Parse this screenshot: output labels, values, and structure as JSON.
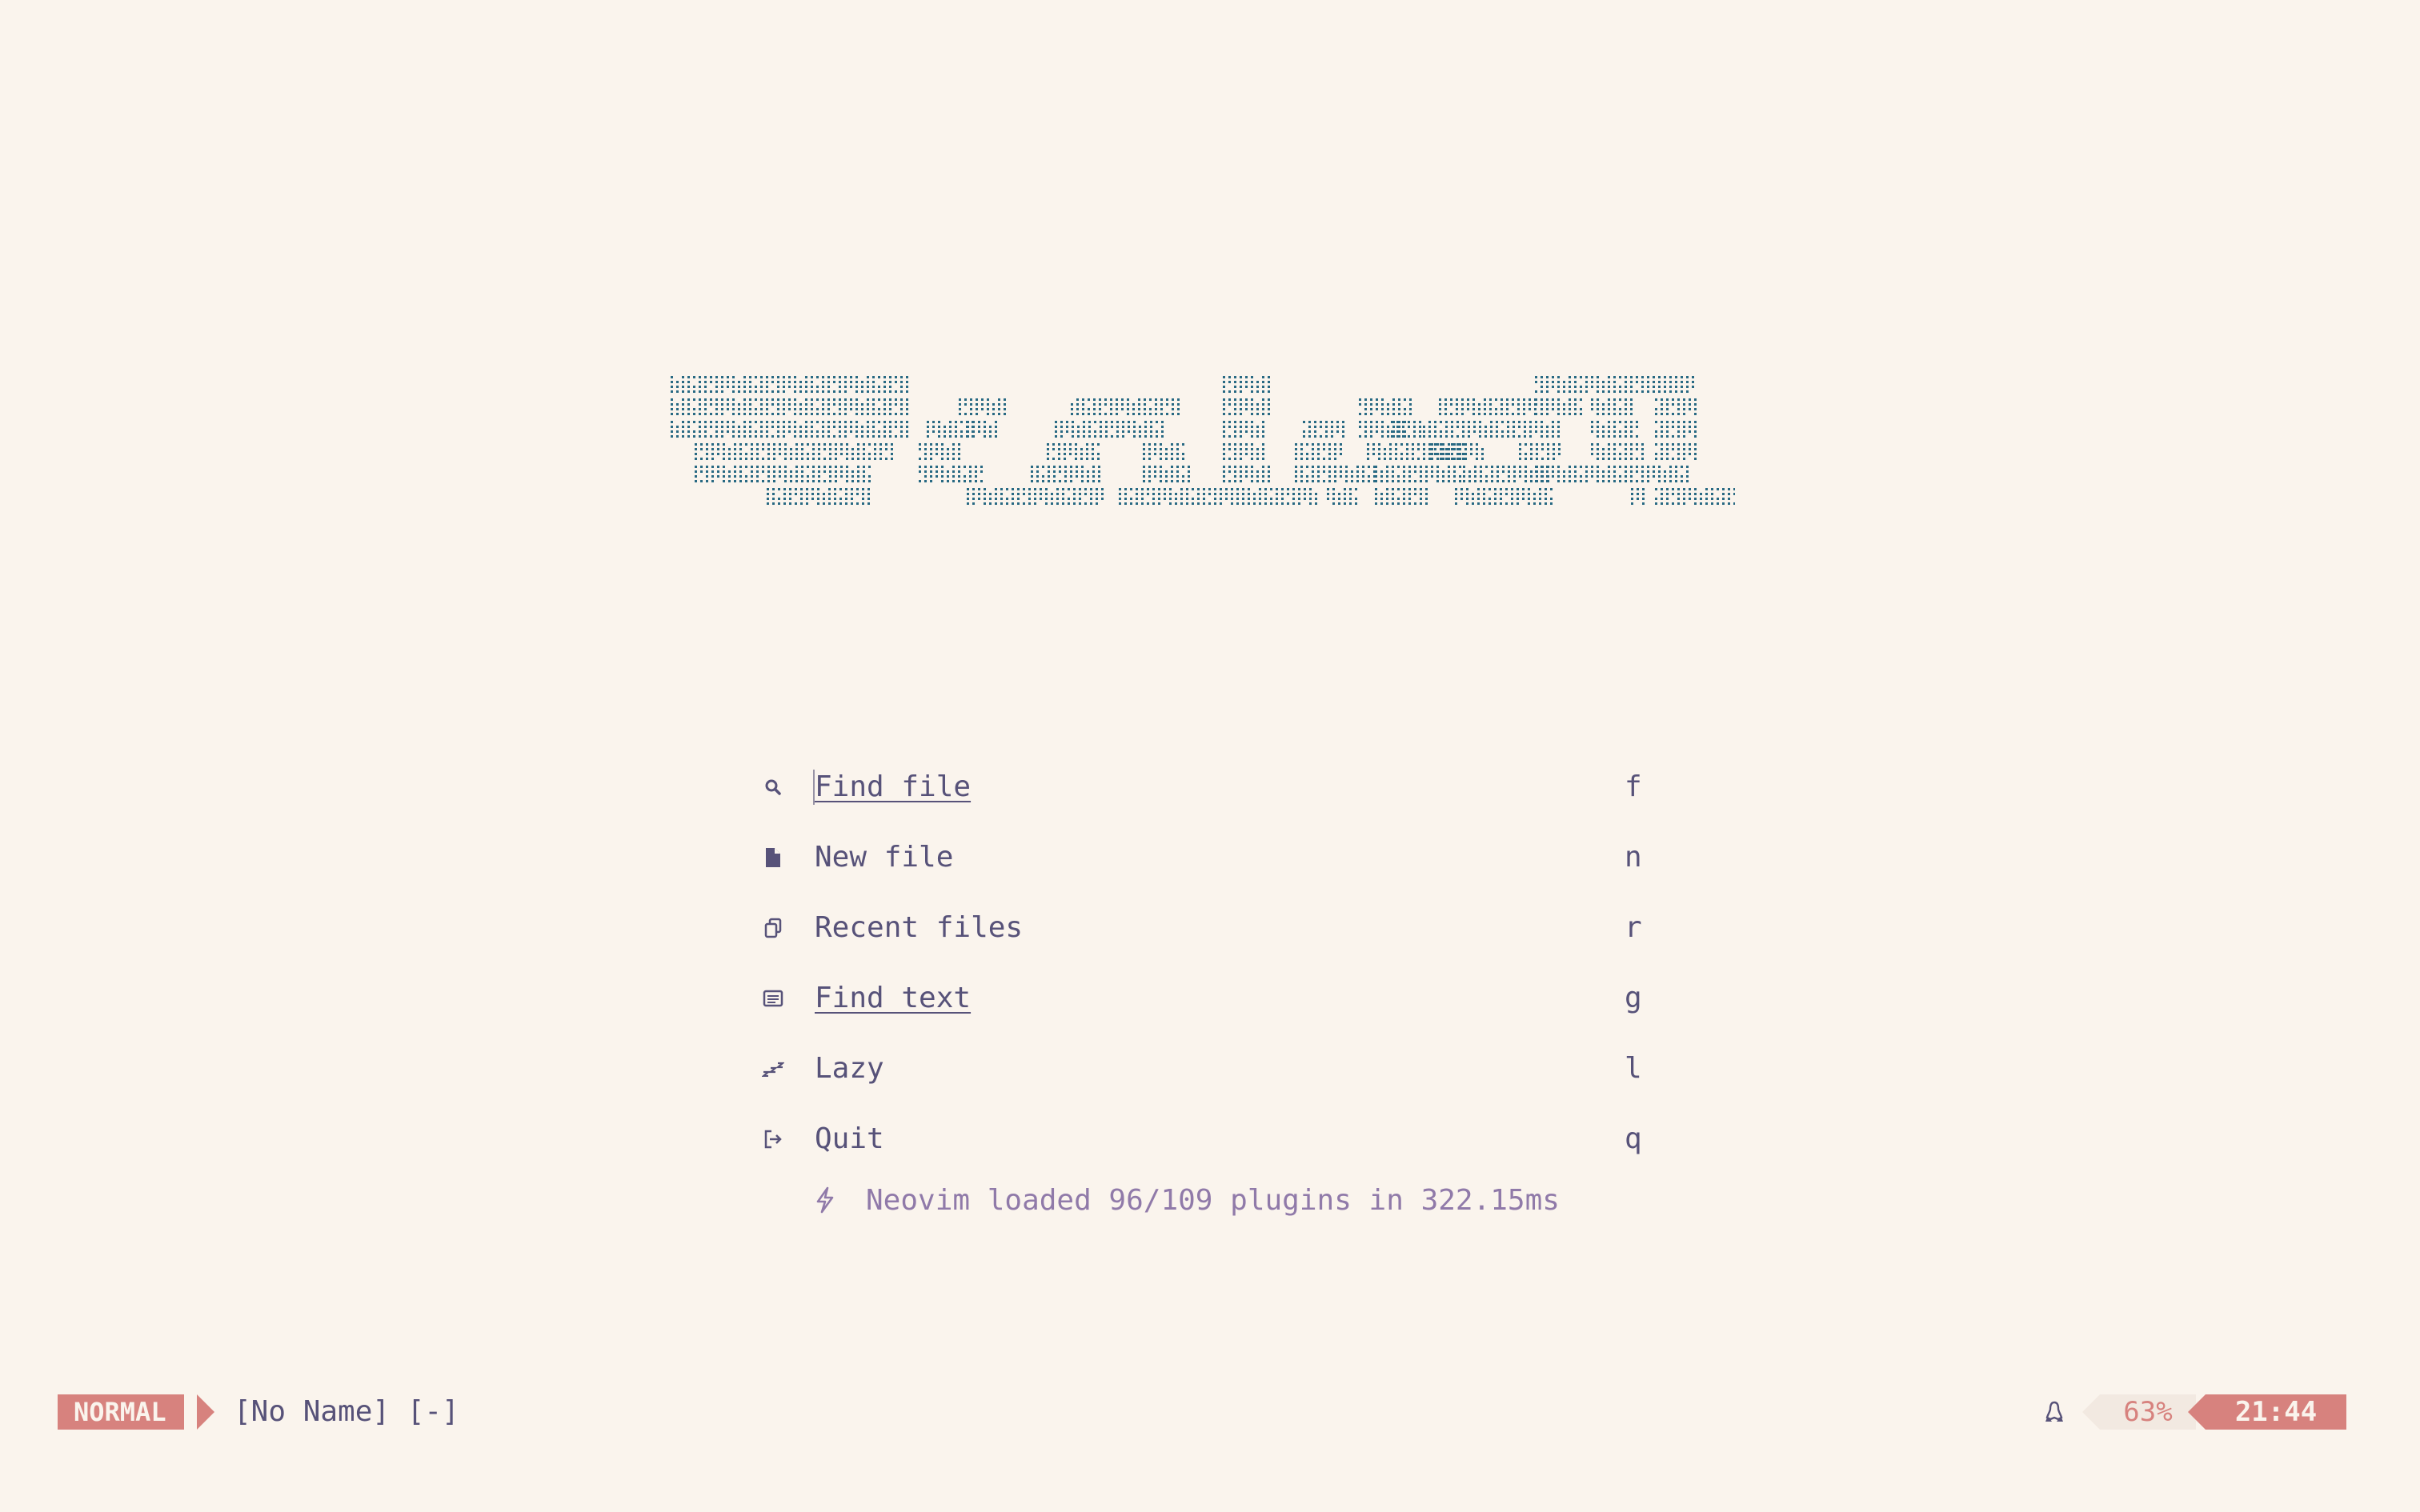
{
  "app": {
    "name": "Neovim dashboard"
  },
  "theme": {
    "background": "#faf4ed",
    "text": "#575279",
    "muted": "#9893a5",
    "accent": "#d7827e",
    "logo": "#286983",
    "footer": "#907aa9",
    "surface": "#f2e9e1"
  },
  "menu": [
    {
      "icon": "search-icon",
      "label": "Find file",
      "key": "f",
      "underline": true
    },
    {
      "icon": "file-icon",
      "label": "New file",
      "key": "n",
      "underline": false
    },
    {
      "icon": "copy-icon",
      "label": "Recent files",
      "key": "r",
      "underline": false
    },
    {
      "icon": "text-search-icon",
      "label": "Find text",
      "key": "g",
      "underline": true
    },
    {
      "icon": "sleep-icon",
      "label": "Lazy",
      "key": "l",
      "underline": false
    },
    {
      "icon": "exit-icon",
      "label": "Quit",
      "key": "q",
      "underline": false
    }
  ],
  "footer": {
    "icon": "bolt-icon",
    "text": "Neovim loaded 96/109 plugins in 322.15ms"
  },
  "statusline": {
    "mode": "NORMAL",
    "filename": "[No Name] [-]",
    "os_icon": "linux-icon",
    "progress": "63%",
    "clock": "21:44"
  }
}
